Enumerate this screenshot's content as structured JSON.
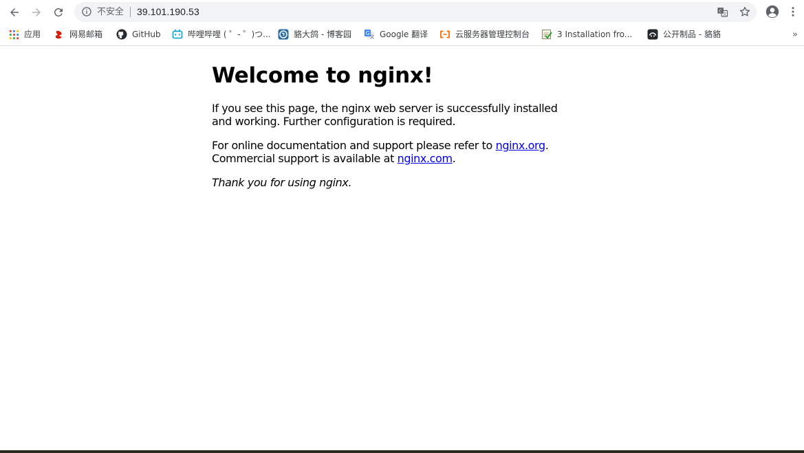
{
  "toolbar": {
    "back_icon": "arrow-left-icon",
    "forward_icon": "arrow-right-icon",
    "reload_icon": "reload-icon",
    "security_label": "不安全",
    "url": "39.101.190.53",
    "translate_icon": "translate-icon",
    "bookmark_icon": "star-icon",
    "profile_icon": "account-icon",
    "menu_icon": "kebab-menu-icon"
  },
  "bookmarks": [
    {
      "label": "应用",
      "icon": "apps-grid-icon"
    },
    {
      "label": "网易邮箱",
      "icon": "netease-mail-icon"
    },
    {
      "label": "GitHub",
      "icon": "github-icon"
    },
    {
      "label": "哔哩哔哩 ( ゜- ゜)つ...",
      "icon": "bilibili-icon"
    },
    {
      "label": "貉大鸽 - 博客园",
      "icon": "cnblogs-icon"
    },
    {
      "label": "Google 翻译",
      "icon": "google-translate-icon"
    },
    {
      "label": "云服务器管理控制台",
      "icon": "aliyun-icon"
    },
    {
      "label": "3 Installation fro...",
      "icon": "docs-icon"
    },
    {
      "label": "公开制品 - 貉貉",
      "icon": "artifact-icon"
    }
  ],
  "bookmarks_more": "»",
  "page": {
    "title": "Welcome to nginx!",
    "p1": "If you see this page, the nginx web server is successfully installed and working. Further configuration is required.",
    "p2_prefix": "For online documentation and support please refer to ",
    "p2_link1": "nginx.org",
    "p2_mid": ".",
    "p2_line2_prefix": "Commercial support is available at ",
    "p2_link2": "nginx.com",
    "p2_suffix": ".",
    "p3": "Thank you for using nginx."
  },
  "colors": {
    "link": "#0000ee",
    "omnibox_bg": "#f1f3f4",
    "icon_grey": "#5f6368"
  }
}
